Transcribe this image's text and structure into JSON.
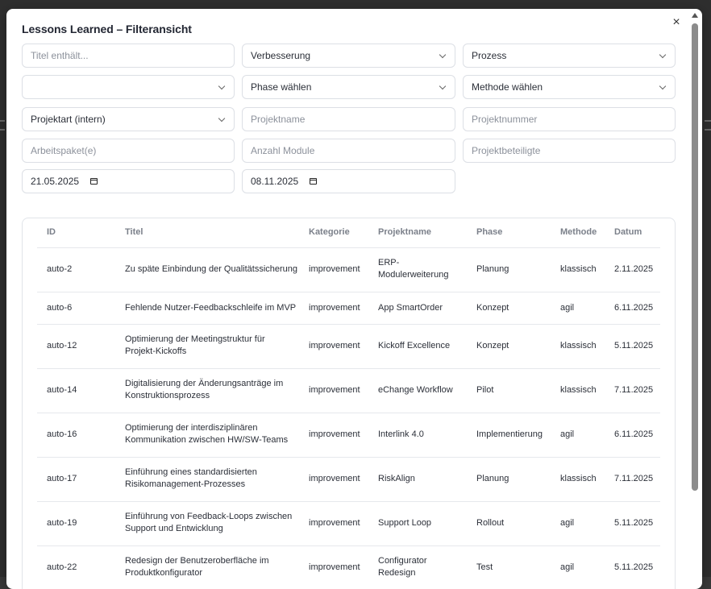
{
  "modal": {
    "title": "Lessons Learned – Filteransicht",
    "close_label": "×"
  },
  "filters": {
    "title_search": {
      "placeholder": "Titel enthält..."
    },
    "kategorie": {
      "value": "Verbesserung"
    },
    "typ": {
      "value": "Prozess"
    },
    "empty_select": {
      "value": ""
    },
    "phase": {
      "value": "Phase wählen"
    },
    "methode": {
      "value": "Methode wählen"
    },
    "projektart": {
      "value": "Projektart (intern)"
    },
    "projektname": {
      "placeholder": "Projektname"
    },
    "projektnummer": {
      "placeholder": "Projektnummer"
    },
    "arbeitspaket": {
      "placeholder": "Arbeitspaket(e)"
    },
    "anzahl_module": {
      "placeholder": "Anzahl Module"
    },
    "projektbeteiligte": {
      "placeholder": "Projektbeteiligte"
    },
    "date_from": {
      "value": "21.05.2025"
    },
    "date_to": {
      "value": "08.11.2025"
    }
  },
  "table": {
    "headers": [
      "ID",
      "Titel",
      "Kategorie",
      "Projektname",
      "Phase",
      "Methode",
      "Datum"
    ],
    "rows": [
      {
        "id": "auto-2",
        "title_lines": [
          "Zu späte Einbindung der Qualitätssicherung"
        ],
        "kategorie": "improvement",
        "projekt_lines": [
          "ERP-",
          "Modulerweiterung"
        ],
        "phase": "Planung",
        "methode": "klassisch",
        "datum": "2.11.2025"
      },
      {
        "id": "auto-6",
        "title_lines": [
          "Fehlende Nutzer-Feedbackschleife im MVP"
        ],
        "kategorie": "improvement",
        "projekt_lines": [
          "App SmartOrder"
        ],
        "phase": "Konzept",
        "methode": "agil",
        "datum": "6.11.2025"
      },
      {
        "id": "auto-12",
        "title_lines": [
          "Optimierung der Meetingstruktur für",
          "Projekt-Kickoffs"
        ],
        "kategorie": "improvement",
        "projekt_lines": [
          "Kickoff Excellence"
        ],
        "phase": "Konzept",
        "methode": "klassisch",
        "datum": "5.11.2025"
      },
      {
        "id": "auto-14",
        "title_lines": [
          "Digitalisierung der Änderungsanträge im",
          "Konstruktionsprozess"
        ],
        "kategorie": "improvement",
        "projekt_lines": [
          "eChange Workflow"
        ],
        "phase": "Pilot",
        "methode": "klassisch",
        "datum": "7.11.2025"
      },
      {
        "id": "auto-16",
        "title_lines": [
          "Optimierung der interdisziplinären",
          "Kommunikation zwischen HW/SW-Teams"
        ],
        "kategorie": "improvement",
        "projekt_lines": [
          "Interlink 4.0"
        ],
        "phase": "Implementierung",
        "methode": "agil",
        "datum": "6.11.2025"
      },
      {
        "id": "auto-17",
        "title_lines": [
          "Einführung eines standardisierten",
          "Risikomanagement-Prozesses"
        ],
        "kategorie": "improvement",
        "projekt_lines": [
          "RiskAlign"
        ],
        "phase": "Planung",
        "methode": "klassisch",
        "datum": "7.11.2025"
      },
      {
        "id": "auto-19",
        "title_lines": [
          "Einführung von Feedback-Loops zwischen",
          "Support und Entwicklung"
        ],
        "kategorie": "improvement",
        "projekt_lines": [
          "Support Loop"
        ],
        "phase": "Rollout",
        "methode": "agil",
        "datum": "5.11.2025"
      },
      {
        "id": "auto-22",
        "title_lines": [
          "Redesign der Benutzeroberfläche im",
          "Produktkonfigurator"
        ],
        "kategorie": "improvement",
        "projekt_lines": [
          "Configurator",
          "Redesign"
        ],
        "phase": "Test",
        "methode": "agil",
        "datum": "5.11.2025"
      }
    ]
  }
}
